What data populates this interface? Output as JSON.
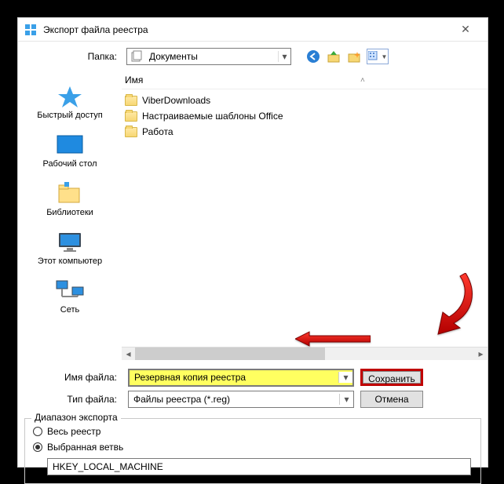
{
  "titlebar": {
    "title": "Экспорт файла реестра"
  },
  "toprow": {
    "folder_label": "Папка:",
    "folder_value": "Документы"
  },
  "sidebar": {
    "items": [
      {
        "label": "Быстрый доступ"
      },
      {
        "label": "Рабочий стол"
      },
      {
        "label": "Библиотеки"
      },
      {
        "label": "Этот компьютер"
      },
      {
        "label": "Сеть"
      }
    ]
  },
  "filehead": {
    "col_name": "Имя"
  },
  "files": [
    {
      "name": "ViberDownloads"
    },
    {
      "name": "Настраиваемые шаблоны Office"
    },
    {
      "name": "Работа"
    }
  ],
  "bottom": {
    "filename_label": "Имя файла:",
    "filename_value": "Резервная копия реестра",
    "filetype_label": "Тип файла:",
    "filetype_value": "Файлы реестра (*.reg)",
    "save_label": "Сохранить",
    "cancel_label": "Отмена"
  },
  "export": {
    "legend": "Диапазон экспорта",
    "opt_all": "Весь реестр",
    "opt_branch": "Выбранная ветвь",
    "branch_value": "HKEY_LOCAL_MACHINE"
  }
}
